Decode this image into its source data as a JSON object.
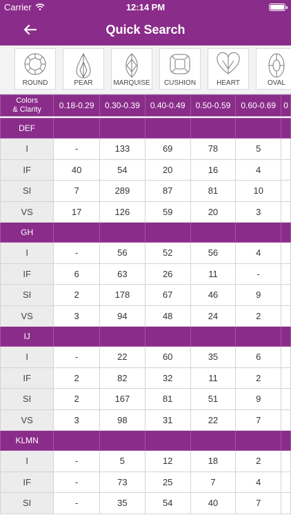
{
  "status": {
    "carrier": "Carrier",
    "time": "12:14 PM"
  },
  "header": {
    "title": "Quick Search"
  },
  "shapes": [
    "ROUND",
    "PEAR",
    "MARQUISE",
    "CUSHION",
    "HEART",
    "OVAL"
  ],
  "table": {
    "corner": [
      "Colors",
      "& Clarity"
    ],
    "columns": [
      "0.18-0.29",
      "0.30-0.39",
      "0.40-0.49",
      "0.50-0.59",
      "0.60-0.69",
      "0"
    ],
    "groups": [
      {
        "name": "DEF",
        "rows": [
          {
            "clarity": "I",
            "values": [
              "-",
              "133",
              "69",
              "78",
              "5",
              ""
            ]
          },
          {
            "clarity": "IF",
            "values": [
              "40",
              "54",
              "20",
              "16",
              "4",
              ""
            ]
          },
          {
            "clarity": "SI",
            "values": [
              "7",
              "289",
              "87",
              "81",
              "10",
              ""
            ]
          },
          {
            "clarity": "VS",
            "values": [
              "17",
              "126",
              "59",
              "20",
              "3",
              ""
            ]
          }
        ]
      },
      {
        "name": "GH",
        "rows": [
          {
            "clarity": "I",
            "values": [
              "-",
              "56",
              "52",
              "56",
              "4",
              ""
            ]
          },
          {
            "clarity": "IF",
            "values": [
              "6",
              "63",
              "26",
              "11",
              "-",
              ""
            ]
          },
          {
            "clarity": "SI",
            "values": [
              "2",
              "178",
              "67",
              "46",
              "9",
              ""
            ]
          },
          {
            "clarity": "VS",
            "values": [
              "3",
              "94",
              "48",
              "24",
              "2",
              ""
            ]
          }
        ]
      },
      {
        "name": "IJ",
        "rows": [
          {
            "clarity": "I",
            "values": [
              "-",
              "22",
              "60",
              "35",
              "6",
              ""
            ]
          },
          {
            "clarity": "IF",
            "values": [
              "2",
              "82",
              "32",
              "11",
              "2",
              ""
            ]
          },
          {
            "clarity": "SI",
            "values": [
              "2",
              "167",
              "81",
              "51",
              "9",
              ""
            ]
          },
          {
            "clarity": "VS",
            "values": [
              "3",
              "98",
              "31",
              "22",
              "7",
              ""
            ]
          }
        ]
      },
      {
        "name": "KLMN",
        "rows": [
          {
            "clarity": "I",
            "values": [
              "-",
              "5",
              "12",
              "18",
              "2",
              ""
            ]
          },
          {
            "clarity": "IF",
            "values": [
              "-",
              "73",
              "25",
              "7",
              "4",
              ""
            ]
          },
          {
            "clarity": "SI",
            "values": [
              "-",
              "35",
              "54",
              "40",
              "7",
              ""
            ]
          }
        ]
      }
    ]
  },
  "colors": {
    "purple": "#8a2c8a",
    "clarity_bg": "#ececec"
  }
}
